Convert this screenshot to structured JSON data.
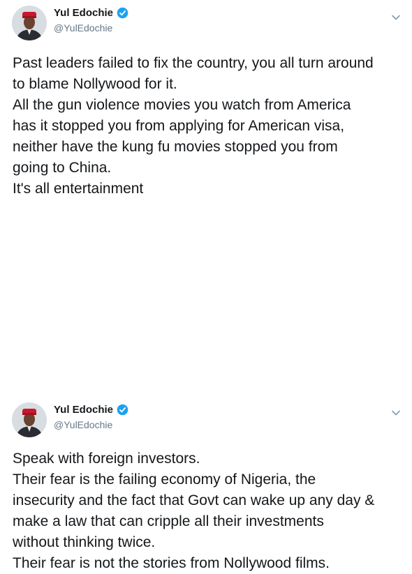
{
  "tweets": [
    {
      "author": {
        "name": "Yul Edochie",
        "handle": "@YulEdochie",
        "verified_icon": "verified-badge-icon",
        "avatar_icon": "avatar-photo"
      },
      "menu_icon": "chevron-down-icon",
      "lines": [
        "Past leaders failed to fix the country, you all turn around",
        "to blame Nollywood for it.",
        "All the gun violence movies you watch from America",
        "has it stopped you from applying for American visa,",
        "neither have the kung fu movies stopped you from",
        "going to China.",
        "It's all entertainment"
      ]
    },
    {
      "author": {
        "name": "Yul Edochie",
        "handle": "@YulEdochie",
        "verified_icon": "verified-badge-icon",
        "avatar_icon": "avatar-photo"
      },
      "menu_icon": "chevron-down-icon",
      "lines": [
        "Speak with foreign investors.",
        "Their fear is the failing economy of Nigeria, the",
        "insecurity and the fact that Govt can wake up any day &",
        "make a law that can cripple all their investments",
        "without thinking twice.",
        "Their fear is not the stories from Nollywood films."
      ]
    }
  ],
  "colors": {
    "text": "#14171a",
    "secondary": "#657786",
    "verified": "#1da1f2"
  }
}
